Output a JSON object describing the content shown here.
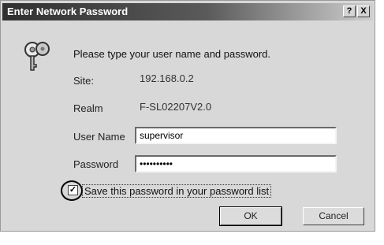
{
  "dialog": {
    "title": "Enter Network Password",
    "help_label": "?",
    "close_label": "X",
    "prompt": "Please type your user name and password.",
    "site_label": "Site:",
    "site_value": "192.168.0.2",
    "realm_label": "Realm",
    "realm_value": "F-SL02207V2.0",
    "username_label": "User Name",
    "username_value": "supervisor",
    "password_label": "Password",
    "password_value": "••••••••••",
    "save_password_label": "Save this password in your password list",
    "save_password_checked": true,
    "ok_label": "OK",
    "cancel_label": "Cancel"
  },
  "icons": {
    "key": "key-icon",
    "checkmark": "checkmark-icon"
  }
}
